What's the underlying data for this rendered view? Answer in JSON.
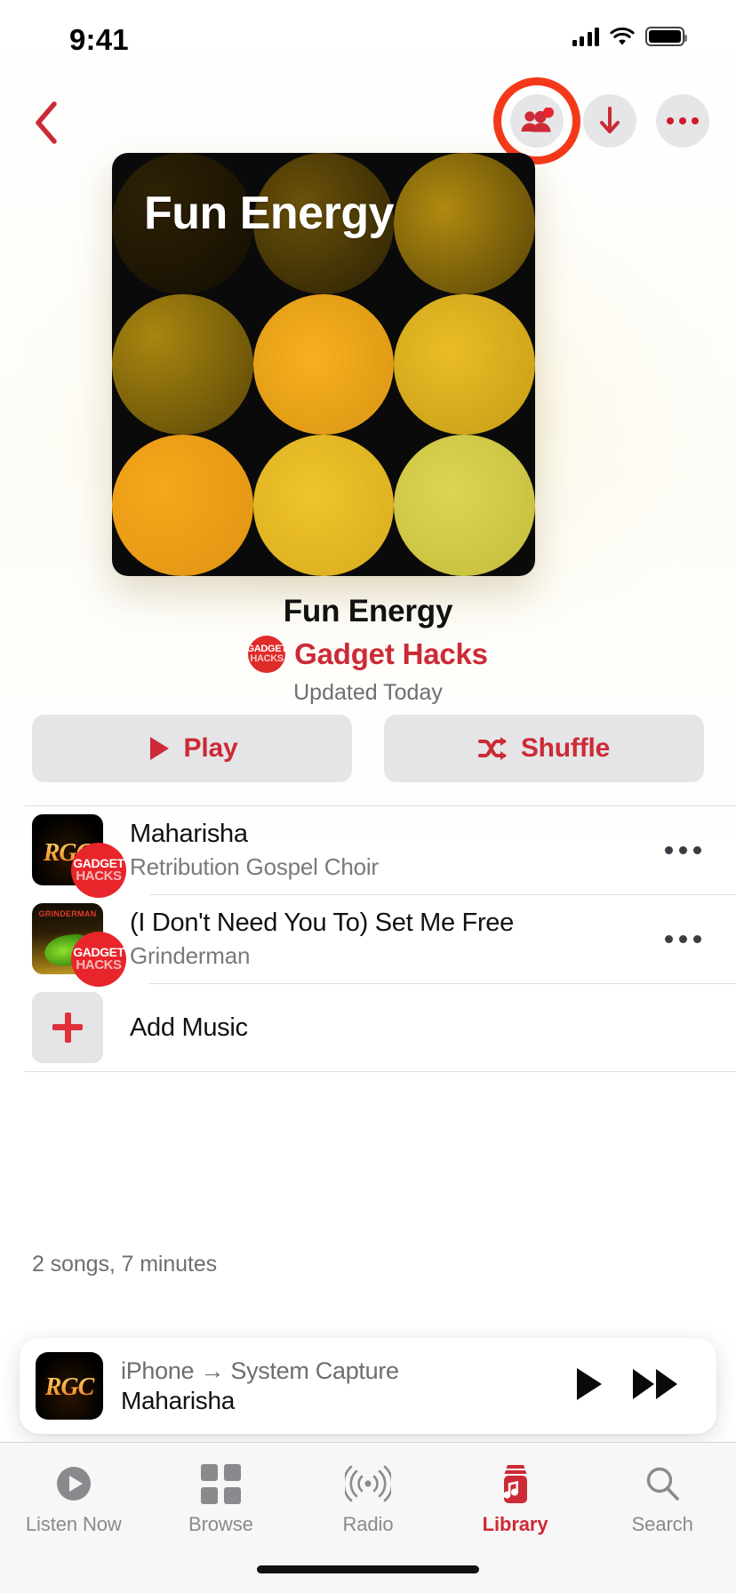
{
  "status_bar": {
    "time": "9:41",
    "cellular_icon": "signal-bars-icon",
    "wifi_icon": "wifi-icon",
    "battery_icon": "battery-full-icon"
  },
  "nav_bar": {
    "back_icon": "back-chevron-icon",
    "collaborate_icon": "people-collaborate-icon",
    "collaborate_has_badge": true,
    "download_icon": "download-arrow-icon",
    "more_icon": "more-ellipsis-icon",
    "highlight_color": "#F4391A"
  },
  "artwork": {
    "overlay_title": "Fun Energy",
    "background": "#0a0a0a",
    "circle_colors": [
      "#221a05",
      "#4a3a08",
      "#8a6c0c",
      "#9a7a10",
      "#f0a41c",
      "#e5b827",
      "#f0a81a",
      "#efbe28",
      "#d9cf46"
    ]
  },
  "playlist": {
    "title": "Fun Energy",
    "artist": "Gadget Hacks",
    "artist_badge_line1": "GADGET",
    "artist_badge_line2": "HACKS",
    "updated": "Updated Today",
    "accent_color": "#cc2a36"
  },
  "actions": {
    "play_label": "Play",
    "play_icon": "play-triangle-icon",
    "shuffle_label": "Shuffle",
    "shuffle_icon": "shuffle-icon"
  },
  "songs": [
    {
      "title": "Maharisha",
      "artist": "Retribution Gospel Choir",
      "art_text": "RGC",
      "overlay_line1": "GADGET",
      "overlay_line2": "HACKS",
      "more_icon": "more-ellipsis-icon"
    },
    {
      "title": "(I Don't Need You To) Set Me Free",
      "artist": "Grinderman",
      "art_text": "GRINDERMAN",
      "overlay_line1": "GADGET",
      "overlay_line2": "HACKS",
      "more_icon": "more-ellipsis-icon"
    }
  ],
  "add_music": {
    "label": "Add Music",
    "icon": "plus-icon"
  },
  "stats": {
    "summary": "2 songs, 7 minutes"
  },
  "mini_player": {
    "route": "iPhone → System Capture",
    "song": "Maharisha",
    "art_text": "RGC",
    "play_icon": "play-triangle-icon",
    "forward_icon": "fast-forward-icon"
  },
  "tab_bar": {
    "items": [
      {
        "label": "Listen Now",
        "icon": "listen-now-icon",
        "active": false
      },
      {
        "label": "Browse",
        "icon": "browse-grid-icon",
        "active": false
      },
      {
        "label": "Radio",
        "icon": "radio-waves-icon",
        "active": false
      },
      {
        "label": "Library",
        "icon": "library-icon",
        "active": true
      },
      {
        "label": "Search",
        "icon": "search-magnifier-icon",
        "active": false
      }
    ],
    "active_color": "#cc2a36",
    "inactive_color": "#8a8a8e"
  }
}
